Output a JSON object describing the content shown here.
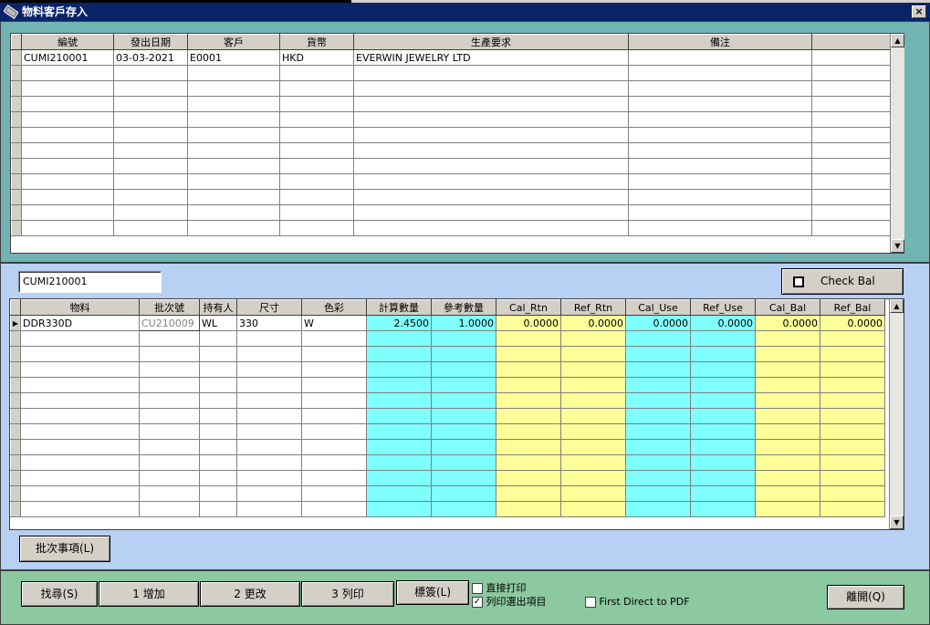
{
  "window": {
    "title": "物料客戶存入",
    "close": "×"
  },
  "top_grid": {
    "columns": [
      "編號",
      "發出日期",
      "客戶",
      "貨幣",
      "生產要求",
      "備注",
      ""
    ],
    "rows": [
      [
        "CUMI210001",
        "03-03-2021",
        "E0001",
        "HKD",
        "EVERWIN JEWELRY LTD",
        "",
        ""
      ]
    ]
  },
  "search_value": "CUMI210001",
  "check_bal": {
    "label": "Check Bal",
    "checked": false
  },
  "detail_grid": {
    "columns": [
      "物料",
      "批次號",
      "持有人",
      "尺寸",
      "色彩",
      "計算數量",
      "參考數量",
      "Cal_Rtn",
      "Ref_Rtn",
      "Cal_Use",
      "Ref_Use",
      "Cal_Bal",
      "Ref_Bal"
    ],
    "rows": [
      [
        "DDR330D",
        "CU210009",
        "WL",
        "330",
        "W",
        "2.4500",
        "1.0000",
        "0.0000",
        "0.0000",
        "0.0000",
        "0.0000",
        "0.0000",
        "0.0000"
      ]
    ]
  },
  "colors": {
    "frame": "#72b4b4",
    "panel": "#b7d0f4",
    "footer": "#8cc8a0",
    "cyan": "#80ffff",
    "yellow": "#ffff99"
  },
  "buttons": {
    "batch": "批次事項(L)",
    "find": "找尋(S)",
    "add": "1 增加",
    "edit": "2 更改",
    "print": "3 列印",
    "label": "標簽(L)",
    "leave": "離開(Q)"
  },
  "options": {
    "direct_print": {
      "label": "直接打印",
      "checked": false
    },
    "print_items": {
      "label": "列印選出項目",
      "checked": true
    },
    "pdf": {
      "label": "First Direct to PDF",
      "checked": false
    }
  }
}
